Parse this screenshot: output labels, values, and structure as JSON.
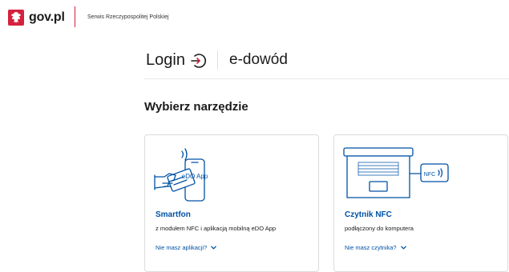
{
  "header": {
    "brand": "gov.pl",
    "service": "Serwis Rzeczypospolitej Polskiej",
    "emblem_icon": "polish-eagle-emblem-icon",
    "accent_color": "#d4213d"
  },
  "login": {
    "title": "Login",
    "icon": "login-arrow-icon",
    "method": "e-dowód"
  },
  "main": {
    "heading": "Wybierz narzędzie",
    "cards": [
      {
        "title": "Smartfon",
        "description": "z modułem NFC i aplikacją mobilną eDO App",
        "link": "Nie masz aplikacji?",
        "illustration_label": "eDO App",
        "illustration_icon": "smartphone-nfc-illustration"
      },
      {
        "title": "Czytnik NFC",
        "description": "podłączony do komputera",
        "link": "Nie masz czytnika?",
        "illustration_label": "NFC",
        "illustration_icon": "laptop-nfc-reader-illustration"
      }
    ]
  },
  "colors": {
    "link": "#0052a5",
    "text": "#1b1b1b",
    "border": "#dcdcdc"
  }
}
